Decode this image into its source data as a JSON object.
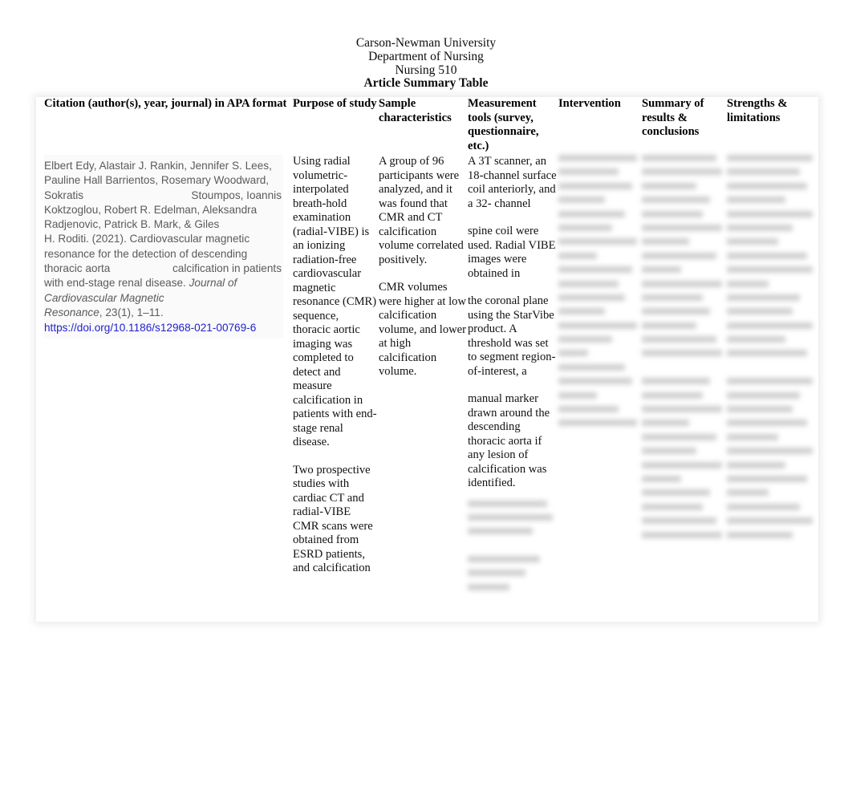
{
  "document": {
    "heading_lines": [
      {
        "text": "Carson-Newman University",
        "bold": false
      },
      {
        "text": "Department of Nursing",
        "bold": false
      },
      {
        "text": "Nursing 510",
        "bold": false
      },
      {
        "text": "Article Summary Table",
        "bold": true
      }
    ]
  },
  "table": {
    "headers": {
      "citation": "Citation (author(s), year, journal) in APA format",
      "purpose": "Purpose of study",
      "sample": "Sample characteristics",
      "tools": "Measurement tools (survey, questionnaire, etc.)",
      "intervention": "Intervention",
      "summary": "Summary of results & conclusions",
      "strengths": "Strengths & limitations"
    },
    "row": {
      "citation": {
        "line1": "Elbert Edy, Alastair J. Rankin, Jennifer S. Lees,",
        "line2": "Pauline Hall Barrientos, Rosemary Woodward,",
        "line3_left": "Sokratis",
        "line3_right": "Stoumpos, Ioannis",
        "line4": "Koktzoglou, Robert R. Edelman, Aleksandra",
        "line5": "Radjenovic, Patrick B. Mark, & Giles",
        "line6": "H. Roditi. (2021). Cardiovascular magnetic",
        "line7": "resonance for the detection of descending",
        "line8_left": "thoracic aorta",
        "line8_right": "calcification in patients",
        "line9_text": "with end-stage renal disease. ",
        "line9_italic": "Journal of",
        "line10_italic": "Cardiovascular Magnetic",
        "line11_italic": "Resonance",
        "line11_text": ", 23(1), 1–11.",
        "doi": "https://doi.org/10.1186/s12968-021-00769-6"
      },
      "purpose": {
        "paragraph_1": "Using radial volumetric-interpolated breath-hold examination (radial-VIBE) is an ionizing radiation-free cardiovascular magnetic resonance (CMR) sequence, thoracic aortic imaging was completed to detect and measure calcification in patients with end-stage renal disease.",
        "paragraph_2": "Two prospective studies with cardiac CT and radial-VIBE CMR scans were obtained from ESRD patients, and calcification"
      },
      "sample": {
        "paragraph_1": "A group of 96 participants were analyzed, and it was found that CMR and CT calcification volume correlated positively.",
        "paragraph_2": "CMR volumes were higher at low calcification volume, and lower at high calcification volume."
      },
      "tools": {
        "paragraph_1": "A 3T scanner, an 18-channel surface coil anteriorly, and a 32- channel",
        "paragraph_2": "spine coil were used.  Radial VIBE images were obtained in",
        "paragraph_3": "the coronal plane using the StarVibe product.  A threshold was set to segment region-of-interest, a",
        "paragraph_4": "manual marker drawn around the descending thoracic aorta if any lesion of calcification was identified.",
        "redacted_note": "[illegible — blurred content]"
      },
      "intervention": {
        "redacted_note": "[illegible — blurred content]"
      },
      "summary": {
        "redacted_note": "[illegible — blurred content]"
      },
      "strengths": {
        "redacted_note": "[illegible — blurred content]"
      }
    }
  }
}
